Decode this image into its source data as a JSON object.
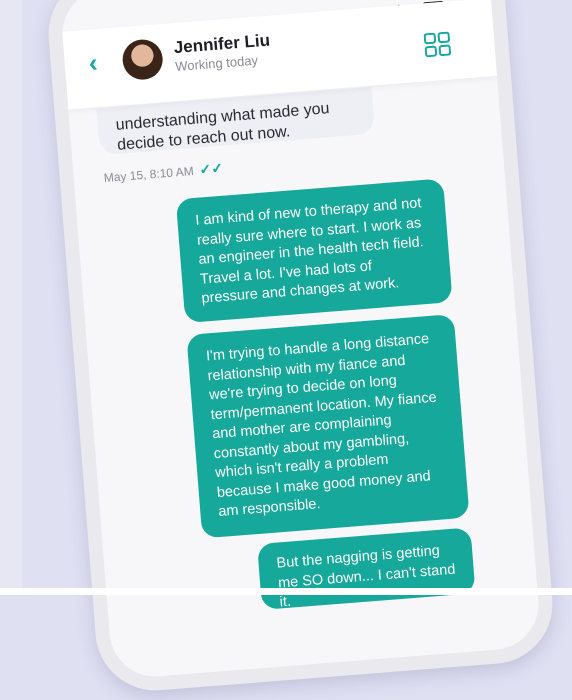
{
  "status_bar": {
    "signal": "ıııl",
    "wifi": "≋"
  },
  "header": {
    "back_icon": "chevron-left-icon",
    "contact_name": "Jennifer Liu",
    "status": "Working today",
    "menu_icon": "grid-menu-icon",
    "accent_color": "#16a89a"
  },
  "messages": {
    "received": {
      "line1": "understanding what made you",
      "line2": "decide to reach out now.",
      "time": "May 15, 8:10 AM"
    },
    "sent": [
      {
        "text": "I am kind of new to therapy and not really sure where to start. I work as an engineer in the health tech field. Travel a lot. I've had lots of pressure and changes at work."
      },
      {
        "text": "I'm trying to handle a long distance relationship with my fiance and we're trying to decide on long term/permanent location. My fiance and mother are complaining constantly about my gambling, which isn't really a problem because I make good money and am responsible."
      },
      {
        "text": "But the nagging is getting me SO down... I can't stand it."
      }
    ]
  }
}
